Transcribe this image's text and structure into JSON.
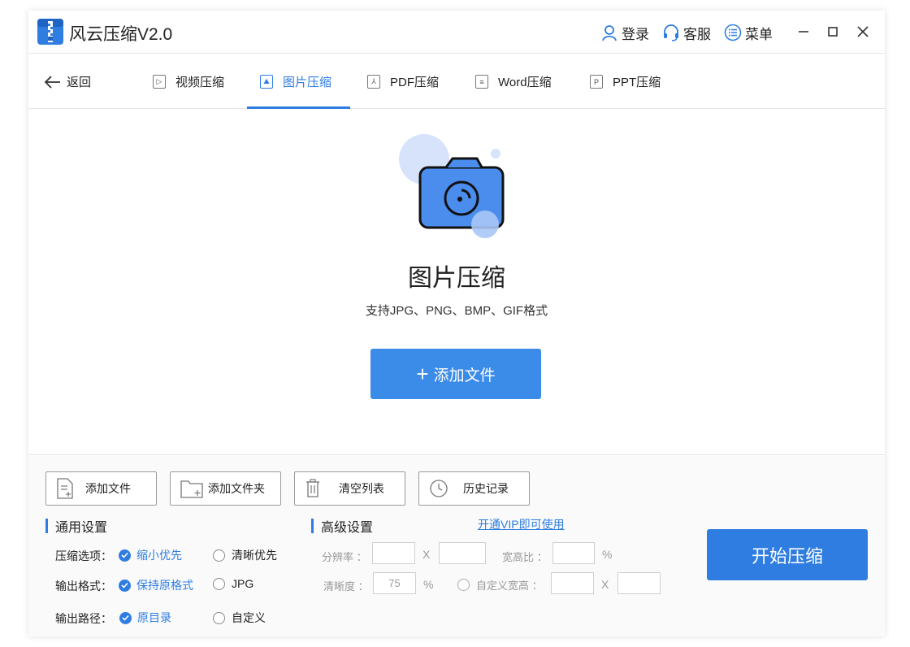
{
  "window": {
    "title": "风云压缩V2.0"
  },
  "titlebar": {
    "login_label": "登录",
    "service_label": "客服",
    "menu_label": "菜单"
  },
  "nav": {
    "back_label": "返回",
    "tabs": [
      {
        "label": "视频压缩",
        "icon": "video-icon",
        "active": false
      },
      {
        "label": "图片压缩",
        "icon": "image-icon",
        "active": true
      },
      {
        "label": "PDF压缩",
        "icon": "pdf-icon",
        "active": false
      },
      {
        "label": "Word压缩",
        "icon": "word-icon",
        "active": false
      },
      {
        "label": "PPT压缩",
        "icon": "ppt-icon",
        "active": false
      }
    ]
  },
  "hero": {
    "title": "图片压缩",
    "subtitle": "支持JPG、PNG、BMP、GIF格式",
    "add_button": "添加文件"
  },
  "toolbar": {
    "add_file": "添加文件",
    "add_folder": "添加文件夹",
    "clear_list": "清空列表",
    "history": "历史记录"
  },
  "general": {
    "title": "通用设置",
    "compress_label": "压缩选项：",
    "compress_opt1": "缩小优先",
    "compress_opt2": "清晰优先",
    "format_label": "输出格式：",
    "format_opt1": "保持原格式",
    "format_opt2": "JPG",
    "path_label": "输出路径：",
    "path_opt1": "原目录",
    "path_opt2": "自定义"
  },
  "advanced": {
    "title": "高级设置",
    "vip_link": "开通VIP即可使用",
    "resolution_label": "分辨率 ：",
    "x_sep": "X",
    "aspect_label": "宽高比 ：",
    "percent": "%",
    "clarity_label": "清晰度 ：",
    "clarity_value": "75",
    "custom_wh_label": "自定义宽高 ："
  },
  "start_button": "开始压缩",
  "colors": {
    "accent": "#2f7de1",
    "button": "#3b8be8"
  }
}
